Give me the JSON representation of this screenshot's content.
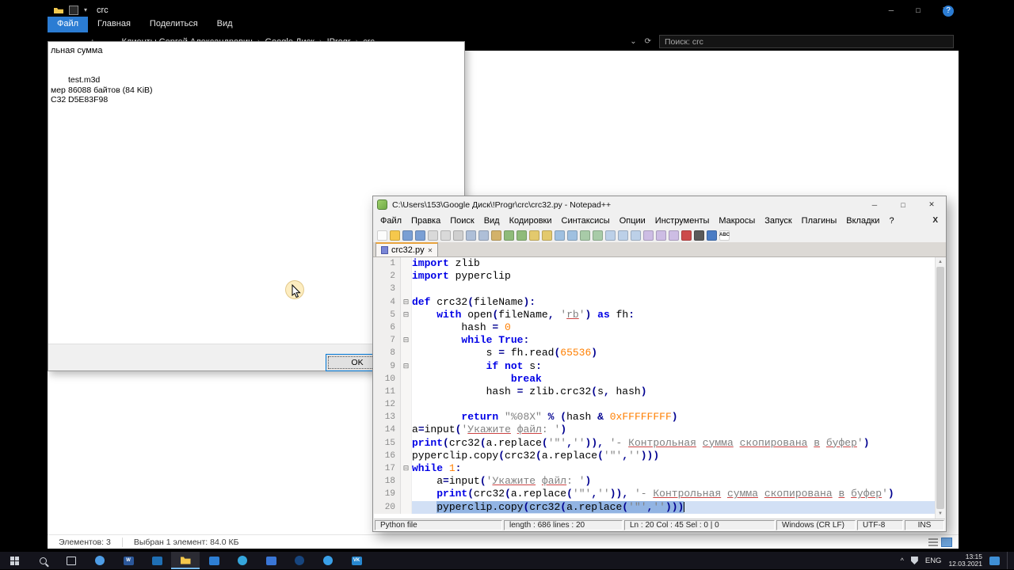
{
  "colors": {
    "accent_blue": "#2b7cd3",
    "keyword": "#0000e6",
    "number": "#ff7f00",
    "string": "#808080",
    "operator": "#000090",
    "selection": "#92b4e3",
    "taskbar_active_underline": "#76b9ed"
  },
  "explorer": {
    "title": "crc",
    "ribbon_tabs": [
      "Файл",
      "Главная",
      "Поделиться",
      "Вид"
    ],
    "help": "?",
    "window_controls": [
      "─",
      "□",
      "✕"
    ],
    "nav_icons": [
      "←",
      "→",
      "↑"
    ],
    "address_icons": [
      "⌄",
      "⟳"
    ],
    "path_segments": [
      "Клиенты Сергей Александрович",
      "Google Диск",
      "!Progr",
      "crc"
    ],
    "search_value": "Поиск: crc",
    "status": {
      "items_count": "Элементов: 3",
      "selection": "Выбран 1 элемент: 84.0 КБ"
    }
  },
  "checksum_dialog": {
    "title": "льная сумма",
    "rows": [
      {
        "label": "",
        "value": "test.m3d"
      },
      {
        "label": "мер",
        "value": "86088 байтов (84 KiB)"
      },
      {
        "label": "C32",
        "value": "D5E83F98"
      }
    ],
    "ok_label": "OK"
  },
  "notepad": {
    "title": "C:\\Users\\153\\Google Диск\\!Progr\\crc\\crc32.py - Notepad++",
    "window_controls": [
      "─",
      "□",
      "✕"
    ],
    "menu": [
      "Файл",
      "Правка",
      "Поиск",
      "Вид",
      "Кодировки",
      "Синтаксисы",
      "Опции",
      "Инструменты",
      "Макросы",
      "Запуск",
      "Плагины",
      "Вкладки",
      "?"
    ],
    "menu_close": "X",
    "active_tab": "crc32.py",
    "toolbar_icons": [
      {
        "name": "new-file",
        "color": "#fcfcfc"
      },
      {
        "name": "open-folder",
        "color": "#f5c84c"
      },
      {
        "name": "save",
        "color": "#7a9fd4"
      },
      {
        "name": "save-all",
        "color": "#7a9fd4"
      },
      {
        "name": "close-file",
        "color": "#d9d9d9"
      },
      {
        "name": "close-all",
        "color": "#d9d9d9"
      },
      {
        "name": "print",
        "color": "#cfcfcf"
      },
      {
        "name": "cut",
        "color": "#aebfd8"
      },
      {
        "name": "copy",
        "color": "#aebfd8"
      },
      {
        "name": "paste",
        "color": "#d3b26a"
      },
      {
        "name": "undo",
        "color": "#8fbb7a"
      },
      {
        "name": "redo",
        "color": "#8fbb7a"
      },
      {
        "name": "find",
        "color": "#e3c96d"
      },
      {
        "name": "replace",
        "color": "#e3c96d"
      },
      {
        "name": "zoom-in",
        "color": "#9fc0e0"
      },
      {
        "name": "zoom-out",
        "color": "#9fc0e0"
      },
      {
        "name": "vertical-sync",
        "color": "#a8cba8"
      },
      {
        "name": "horizontal-sync",
        "color": "#a8cba8"
      },
      {
        "name": "word-wrap",
        "color": "#bcd0e8"
      },
      {
        "name": "show-all-characters",
        "color": "#bcd0e8"
      },
      {
        "name": "indent-guide",
        "color": "#bcd0e8"
      },
      {
        "name": "function-list",
        "color": "#cdbde4"
      },
      {
        "name": "document-map",
        "color": "#cdbde4"
      },
      {
        "name": "document-switcher",
        "color": "#cdbde4"
      },
      {
        "name": "record-macro",
        "color": "#cc4b4b"
      },
      {
        "name": "stop-macro",
        "color": "#5a5a5a"
      },
      {
        "name": "play-macro",
        "color": "#4a7cc4"
      },
      {
        "name": "spell-check",
        "color": "#ffffff",
        "glyph": "ABC"
      }
    ],
    "code_lines": [
      {
        "n": 1,
        "seg": [
          [
            "k",
            "import"
          ],
          [
            "t",
            " zlib"
          ]
        ]
      },
      {
        "n": 2,
        "seg": [
          [
            "k",
            "import"
          ],
          [
            "t",
            " pyperclip"
          ]
        ]
      },
      {
        "n": 3,
        "seg": [
          [
            "t",
            ""
          ]
        ]
      },
      {
        "n": 4,
        "f": 1,
        "seg": [
          [
            "k",
            "def"
          ],
          [
            "t",
            " crc32"
          ],
          [
            "o",
            "("
          ],
          [
            "t",
            "fileName"
          ],
          [
            "o",
            "):"
          ]
        ]
      },
      {
        "n": 5,
        "f": 1,
        "seg": [
          [
            "t",
            "    "
          ],
          [
            "k",
            "with"
          ],
          [
            "t",
            " open"
          ],
          [
            "o",
            "("
          ],
          [
            "t",
            "fileName"
          ],
          [
            "o",
            ","
          ],
          [
            "t",
            " "
          ],
          [
            "s",
            "'"
          ],
          [
            "m",
            "rb"
          ],
          [
            "s",
            "'"
          ],
          [
            "o",
            ")"
          ],
          [
            "t",
            " "
          ],
          [
            "k",
            "as"
          ],
          [
            "t",
            " fh"
          ],
          [
            "o",
            ":"
          ]
        ]
      },
      {
        "n": 6,
        "seg": [
          [
            "t",
            "        hash "
          ],
          [
            "o",
            "="
          ],
          [
            "t",
            " "
          ],
          [
            "n",
            "0"
          ]
        ]
      },
      {
        "n": 7,
        "f": 1,
        "seg": [
          [
            "t",
            "        "
          ],
          [
            "k",
            "while"
          ],
          [
            "t",
            " "
          ],
          [
            "k",
            "True"
          ],
          [
            "o",
            ":"
          ]
        ]
      },
      {
        "n": 8,
        "seg": [
          [
            "t",
            "            s "
          ],
          [
            "o",
            "="
          ],
          [
            "t",
            " fh.read"
          ],
          [
            "o",
            "("
          ],
          [
            "n",
            "65536"
          ],
          [
            "o",
            ")"
          ]
        ]
      },
      {
        "n": 9,
        "f": 1,
        "seg": [
          [
            "t",
            "            "
          ],
          [
            "k",
            "if"
          ],
          [
            "t",
            " "
          ],
          [
            "k",
            "not"
          ],
          [
            "t",
            " s"
          ],
          [
            "o",
            ":"
          ]
        ]
      },
      {
        "n": 10,
        "seg": [
          [
            "t",
            "                "
          ],
          [
            "k",
            "break"
          ]
        ]
      },
      {
        "n": 11,
        "seg": [
          [
            "t",
            "            hash "
          ],
          [
            "o",
            "="
          ],
          [
            "t",
            " zlib.crc32"
          ],
          [
            "o",
            "("
          ],
          [
            "t",
            "s"
          ],
          [
            "o",
            ","
          ],
          [
            "t",
            " hash"
          ],
          [
            "o",
            ")"
          ]
        ]
      },
      {
        "n": 12,
        "seg": [
          [
            "t",
            ""
          ]
        ]
      },
      {
        "n": 13,
        "seg": [
          [
            "t",
            "        "
          ],
          [
            "k",
            "return"
          ],
          [
            "t",
            " "
          ],
          [
            "s",
            "\"%08X\""
          ],
          [
            "t",
            " "
          ],
          [
            "o",
            "%"
          ],
          [
            "t",
            " "
          ],
          [
            "o",
            "("
          ],
          [
            "t",
            "hash "
          ],
          [
            "o",
            "&"
          ],
          [
            "t",
            " "
          ],
          [
            "n",
            "0xFFFFFFFF"
          ],
          [
            "o",
            ")"
          ]
        ]
      },
      {
        "n": 14,
        "seg": [
          [
            "t",
            "a"
          ],
          [
            "o",
            "="
          ],
          [
            "t",
            "input"
          ],
          [
            "o",
            "("
          ],
          [
            "s",
            "'"
          ],
          [
            "m",
            "Укажите"
          ],
          [
            "s",
            " "
          ],
          [
            "m",
            "файл"
          ],
          [
            "s",
            ": '"
          ],
          [
            "o",
            ")"
          ]
        ]
      },
      {
        "n": 15,
        "seg": [
          [
            "k",
            "print"
          ],
          [
            "o",
            "("
          ],
          [
            "t",
            "crc32"
          ],
          [
            "o",
            "("
          ],
          [
            "t",
            "a.replace"
          ],
          [
            "o",
            "("
          ],
          [
            "s",
            "'\"'"
          ],
          [
            "o",
            ","
          ],
          [
            "s",
            "''"
          ],
          [
            "o",
            ")),"
          ],
          [
            "t",
            " "
          ],
          [
            "s",
            "'- "
          ],
          [
            "m",
            "Контрольная"
          ],
          [
            "s",
            " "
          ],
          [
            "m",
            "сумма"
          ],
          [
            "s",
            " "
          ],
          [
            "m",
            "скопирована"
          ],
          [
            "s",
            " "
          ],
          [
            "m",
            "в"
          ],
          [
            "s",
            " "
          ],
          [
            "m",
            "буфер"
          ],
          [
            "s",
            "'"
          ],
          [
            "o",
            ")"
          ]
        ]
      },
      {
        "n": 16,
        "seg": [
          [
            "t",
            "pyperclip.copy"
          ],
          [
            "o",
            "("
          ],
          [
            "t",
            "crc32"
          ],
          [
            "o",
            "("
          ],
          [
            "t",
            "a.replace"
          ],
          [
            "o",
            "("
          ],
          [
            "s",
            "'\"'"
          ],
          [
            "o",
            ","
          ],
          [
            "s",
            "''"
          ],
          [
            "o",
            ")))"
          ]
        ]
      },
      {
        "n": 17,
        "f": 1,
        "seg": [
          [
            "k",
            "while"
          ],
          [
            "t",
            " "
          ],
          [
            "n",
            "1"
          ],
          [
            "o",
            ":"
          ]
        ]
      },
      {
        "n": 18,
        "seg": [
          [
            "t",
            "    a"
          ],
          [
            "o",
            "="
          ],
          [
            "t",
            "input"
          ],
          [
            "o",
            "("
          ],
          [
            "s",
            "'"
          ],
          [
            "m",
            "Укажите"
          ],
          [
            "s",
            " "
          ],
          [
            "m",
            "файл"
          ],
          [
            "s",
            ": '"
          ],
          [
            "o",
            ")"
          ]
        ]
      },
      {
        "n": 19,
        "seg": [
          [
            "t",
            "    "
          ],
          [
            "k",
            "print"
          ],
          [
            "o",
            "("
          ],
          [
            "t",
            "crc32"
          ],
          [
            "o",
            "("
          ],
          [
            "t",
            "a.replace"
          ],
          [
            "o",
            "("
          ],
          [
            "s",
            "'\"'"
          ],
          [
            "o",
            ","
          ],
          [
            "s",
            "''"
          ],
          [
            "o",
            ")),"
          ],
          [
            "t",
            " "
          ],
          [
            "s",
            "'- "
          ],
          [
            "m",
            "Контрольная"
          ],
          [
            "s",
            " "
          ],
          [
            "m",
            "сумма"
          ],
          [
            "s",
            " "
          ],
          [
            "m",
            "скопирована"
          ],
          [
            "s",
            " "
          ],
          [
            "m",
            "в"
          ],
          [
            "s",
            " "
          ],
          [
            "m",
            "буфер"
          ],
          [
            "s",
            "'"
          ],
          [
            "o",
            ")"
          ]
        ]
      },
      {
        "n": 20,
        "sel": true,
        "selFrom": 1,
        "caret": true,
        "seg": [
          [
            "t",
            "    "
          ],
          [
            "t",
            "pyperclip.copy"
          ],
          [
            "o",
            "("
          ],
          [
            "t",
            "crc32"
          ],
          [
            "o",
            "("
          ],
          [
            "t",
            "a.replace"
          ],
          [
            "o",
            "("
          ],
          [
            "s",
            "'\"'"
          ],
          [
            "o",
            ","
          ],
          [
            "s",
            "''"
          ],
          [
            "o",
            ")))"
          ]
        ]
      }
    ],
    "status_bar": {
      "doc_type": "Python file",
      "length_info": "length : 686  lines : 20",
      "caret_info": "Ln : 20   Col : 45   Sel : 0 | 0",
      "eol": "Windows (CR LF)",
      "encoding": "UTF-8",
      "mode": "INS"
    }
  },
  "taskbar": {
    "apps": [
      {
        "name": "browser-icon",
        "shape": "circle",
        "color": "#4e9de6"
      },
      {
        "name": "word-icon",
        "shape": "square",
        "color": "#2b579a",
        "glyph": "W"
      },
      {
        "name": "mail-icon",
        "shape": "square",
        "color": "#1f6fb4"
      },
      {
        "name": "explorer-icon",
        "shape": "folder",
        "color": "#f5c84c",
        "active": true
      },
      {
        "name": "photos-icon",
        "shape": "square",
        "color": "#2e7fd4"
      },
      {
        "name": "telegram-icon",
        "shape": "circle",
        "color": "#35a6dc"
      },
      {
        "name": "app-icon-7",
        "shape": "square",
        "color": "#3a76d6"
      },
      {
        "name": "steam-icon",
        "shape": "circle",
        "color": "#17457e"
      },
      {
        "name": "app-icon-9",
        "shape": "circle",
        "color": "#3aa0e8"
      },
      {
        "name": "vk-icon",
        "shape": "square",
        "color": "#2787cf",
        "glyph": "VK"
      }
    ],
    "tray_caret": "^",
    "tray_lang": "ENG",
    "tray_time": "13:15",
    "tray_date": "12.03.2021"
  }
}
